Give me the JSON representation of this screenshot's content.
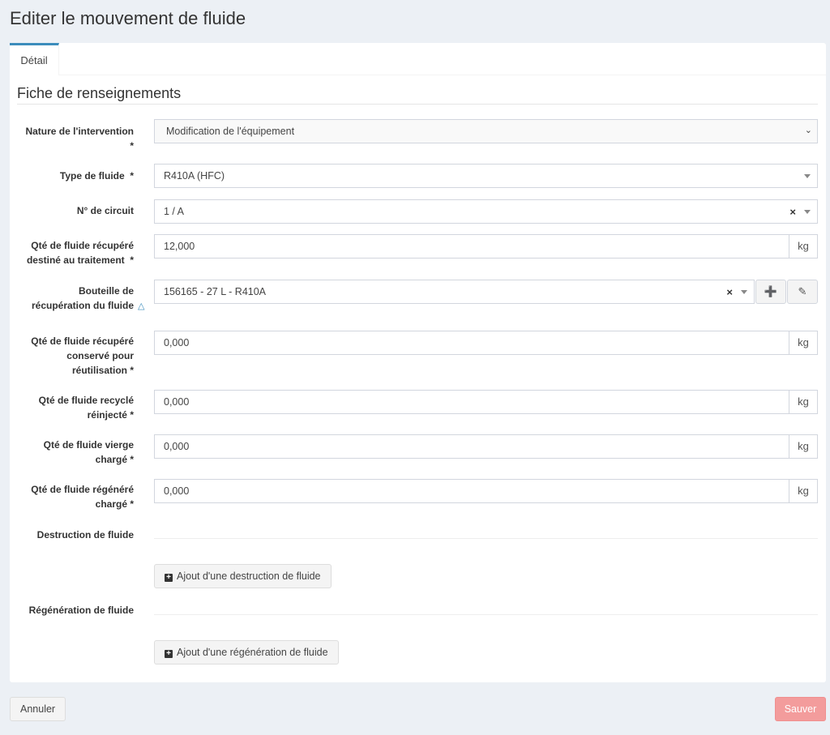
{
  "page": {
    "title": "Editer le mouvement de fluide"
  },
  "tabs": [
    {
      "label": "Détail"
    }
  ],
  "section": {
    "title": "Fiche de renseignements"
  },
  "fields": {
    "nature": {
      "label": "Nature de l'intervention",
      "required": "*",
      "value": "Modification de l'équipement"
    },
    "type": {
      "label": "Type de fluide  *",
      "value": "R410A (HFC)"
    },
    "circuit": {
      "label": "N° de circuit",
      "value": "1 / A",
      "clear": "×"
    },
    "qte_traitement": {
      "label": "Qté de fluide récupéré destiné au traitement  *",
      "value": "12,000",
      "unit": "kg"
    },
    "bouteille": {
      "label": "Bouteille de récupération du fluide",
      "value": "156165 - 27 L - R410A",
      "clear": "×"
    },
    "qte_reutilisation": {
      "label": "Qté de fluide récupéré conservé pour réutilisation  *",
      "value": "0,000",
      "unit": "kg"
    },
    "qte_recycle": {
      "label": "Qté de fluide recyclé réinjecté  *",
      "value": "0,000",
      "unit": "kg"
    },
    "qte_vierge": {
      "label": "Qté de fluide vierge chargé  *",
      "value": "0,000",
      "unit": "kg"
    },
    "qte_regenere": {
      "label": "Qté de fluide régénéré chargé  *",
      "value": "0,000",
      "unit": "kg"
    }
  },
  "destruction": {
    "label": "Destruction de fluide",
    "button": "Ajout d'une destruction de fluide"
  },
  "regeneration": {
    "label": "Régénération de fluide",
    "button": "Ajout d'une régénération de fluide"
  },
  "footer": {
    "cancel": "Annuler",
    "save": "Sauver"
  },
  "colors": {
    "accent": "#3c8dbc",
    "save": "#f39c9c"
  }
}
